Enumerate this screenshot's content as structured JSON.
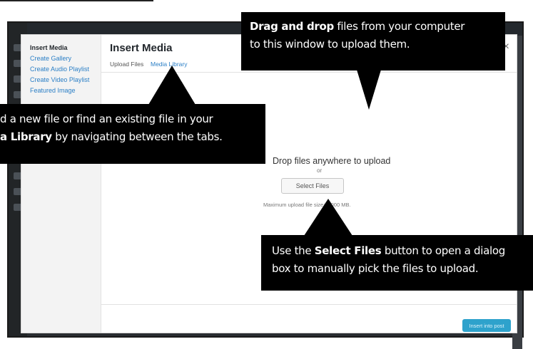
{
  "wp_menu": {
    "items": [
      "Insert Media",
      "Create Gallery",
      "Create Audio Playlist",
      "Create Video Playlist",
      "Featured Image"
    ]
  },
  "modal": {
    "title": "Insert Media",
    "tabs": [
      "Upload Files",
      "Media Library"
    ],
    "close_glyph": "×",
    "drop_text": "Drop files anywhere to upload",
    "or_text": "or",
    "select_files_label": "Select Files",
    "max_upload_text": "Maximum upload file size: 1,000 MB.",
    "insert_button_label": "Insert into post"
  },
  "callouts": {
    "drag_drop": {
      "bold": "Drag and drop",
      "line1_rest": " files from your computer",
      "line2": "to this window to upload them."
    },
    "tabs": {
      "line1": "d a new file or find an existing file in your",
      "bold": "a Library",
      "line2_rest": " by navigating between the tabs."
    },
    "select_files": {
      "prefix": "Use the ",
      "bold": "Select Files",
      "line1_rest": " button to open a dialog",
      "line2": "box to manually pick the files to upload."
    }
  },
  "colors": {
    "callout_bg": "#000000",
    "admin_dark": "#23282d",
    "link_blue": "#2b7fc6",
    "primary_button": "#2ea2cc"
  }
}
